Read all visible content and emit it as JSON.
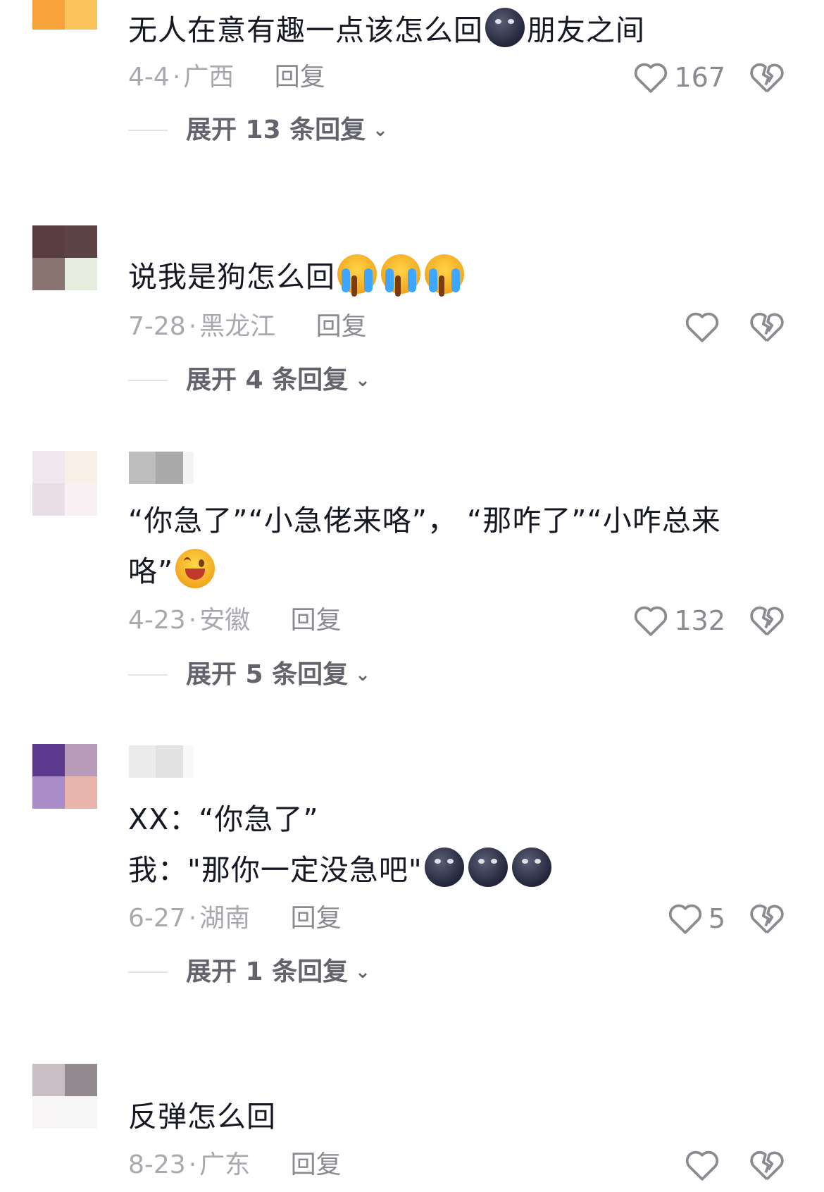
{
  "comments": [
    {
      "text": "无人在意有趣一点该怎么回",
      "emoji_after": "moon-emoji",
      "text_tail": "朋友之间",
      "date": "4-4",
      "location": "广西",
      "reply_label": "回复",
      "likes": "167",
      "expand_label": "展开 13 条回复"
    },
    {
      "text": "说我是狗怎么回",
      "emojis": [
        "crying-emoji",
        "crying-emoji",
        "crying-emoji"
      ],
      "date": "7-28",
      "location": "黑龙江",
      "reply_label": "回复",
      "likes": "",
      "expand_label": "展开 4 条回复"
    },
    {
      "text_line1": "“你急了”“小急佬来咯”， “那咋了”“小咋总来",
      "text_line2": "咯”",
      "emoji_after": "laughing-emoji",
      "date": "4-23",
      "location": "安徽",
      "reply_label": "回复",
      "likes": "132",
      "expand_label": "展开 5 条回复"
    },
    {
      "text_line1": "XX：“你急了”",
      "text_line2": "我：\"那你一定没急吧\"",
      "emojis": [
        "moon-emoji",
        "moon-emoji",
        "moon-emoji"
      ],
      "date": "6-27",
      "location": "湖南",
      "reply_label": "回复",
      "likes": "5",
      "expand_label": "展开 1 条回复"
    },
    {
      "text": "反弹怎么回",
      "date": "8-23",
      "location": "广东",
      "reply_label": "回复",
      "likes": ""
    }
  ],
  "meta_separator": "·",
  "expand_chevron": "⌄",
  "colors": {
    "text": "#161823",
    "meta": "#a8a9ae",
    "reply": "#8a8b91",
    "expand": "#62636b",
    "icon": "#8a8b91"
  }
}
